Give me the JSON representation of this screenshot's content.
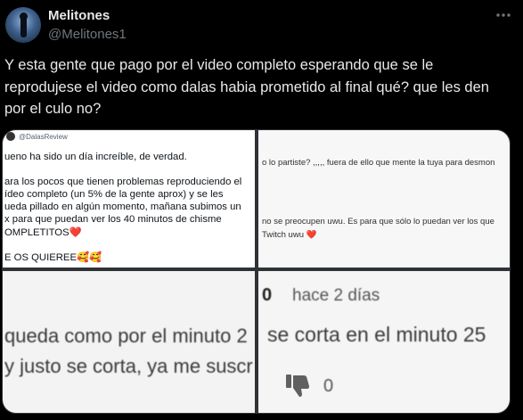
{
  "author": {
    "display_name": "Melitones",
    "handle": "@Melitones1"
  },
  "tweet": {
    "text": "Y esta gente que pago por el video completo esperando que se le reprodujese el video como dalas habia prometido al final qué? que les den por el culo no?"
  },
  "media": {
    "top_left": {
      "source": "@DalasReview",
      "line1": "ueno ha sido un día increíble, de verdad.",
      "line2": "ara los pocos que tienen problemas reproduciendo el",
      "line3": "ídeo completo (un 5% de la gente aprox) y se les",
      "line4": "ueda pillado en algún momento, mañana subimos un",
      "line5": "x para que puedan ver los 40 minutos de chisme",
      "line6": "OMPLETITOS",
      "line6_emoji": "❤️",
      "line7": "E OS QUIEREE",
      "line7_emoji": "🥰🥰"
    },
    "top_right": {
      "line1": "o lo partiste? ,,,,, fuera de ello que mente la tuya para desmon",
      "line2": "no se preocupen uwu. Es para que sólo lo puedan ver los que",
      "line3": "Twitch uwu",
      "line3_emoji": "❤️"
    },
    "bottom_left": {
      "line1": "queda como por el minuto 2",
      "line2": "y justo se corta, ya me suscr"
    },
    "bottom_right": {
      "count_prefix": "0",
      "time": "hace 2 días",
      "line1": "se corta en el minuto 25",
      "likes": "0"
    }
  },
  "icons": {
    "more": "more-horizontal-icon",
    "dislike": "thumbs-down-icon"
  }
}
